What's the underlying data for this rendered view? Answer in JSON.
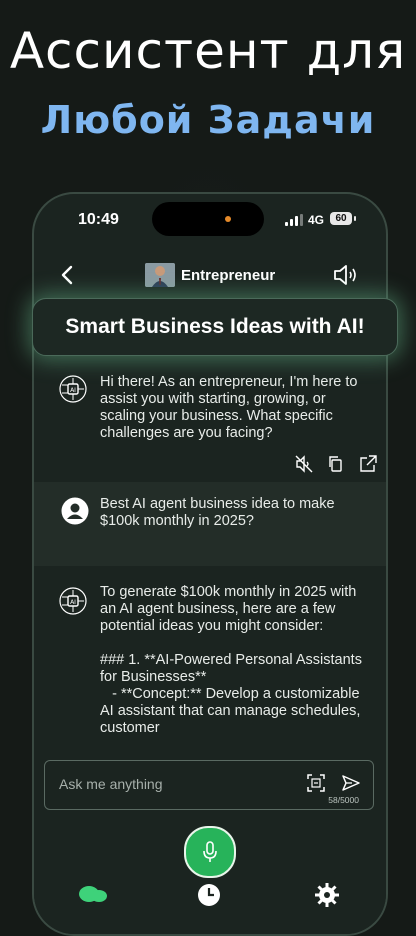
{
  "headline": {
    "line1": "Ассистент для",
    "line2": "Любой Задачи"
  },
  "status_bar": {
    "time": "10:49",
    "network": "4G",
    "battery": "60"
  },
  "chat_header": {
    "back_icon": "chevron-left-icon",
    "title": "Entrepreneur",
    "speaker_icon": "speaker-icon"
  },
  "banner": {
    "text": "Smart Business Ideas with AI!"
  },
  "messages": [
    {
      "role": "bot",
      "text": "Hi there! As an entrepreneur, I'm here to assist you with starting, growing, or scaling your business. What specific challenges are you facing?"
    },
    {
      "role": "user",
      "text": "Best AI agent business idea to make $100k monthly in 2025?"
    },
    {
      "role": "bot",
      "text": "To generate $100k monthly in 2025 with an AI agent business, here are a few potential ideas you might consider:\n\n### 1. **AI-Powered Personal Assistants for Businesses**\n   - **Concept:** Develop a customizable AI assistant that can manage schedules, customer"
    }
  ],
  "input": {
    "placeholder": "Ask me anything",
    "counter": "58/5000"
  },
  "colors": {
    "accent": "#27b35a",
    "headline_blue": "#7fb6f0",
    "background": "#151a17"
  }
}
